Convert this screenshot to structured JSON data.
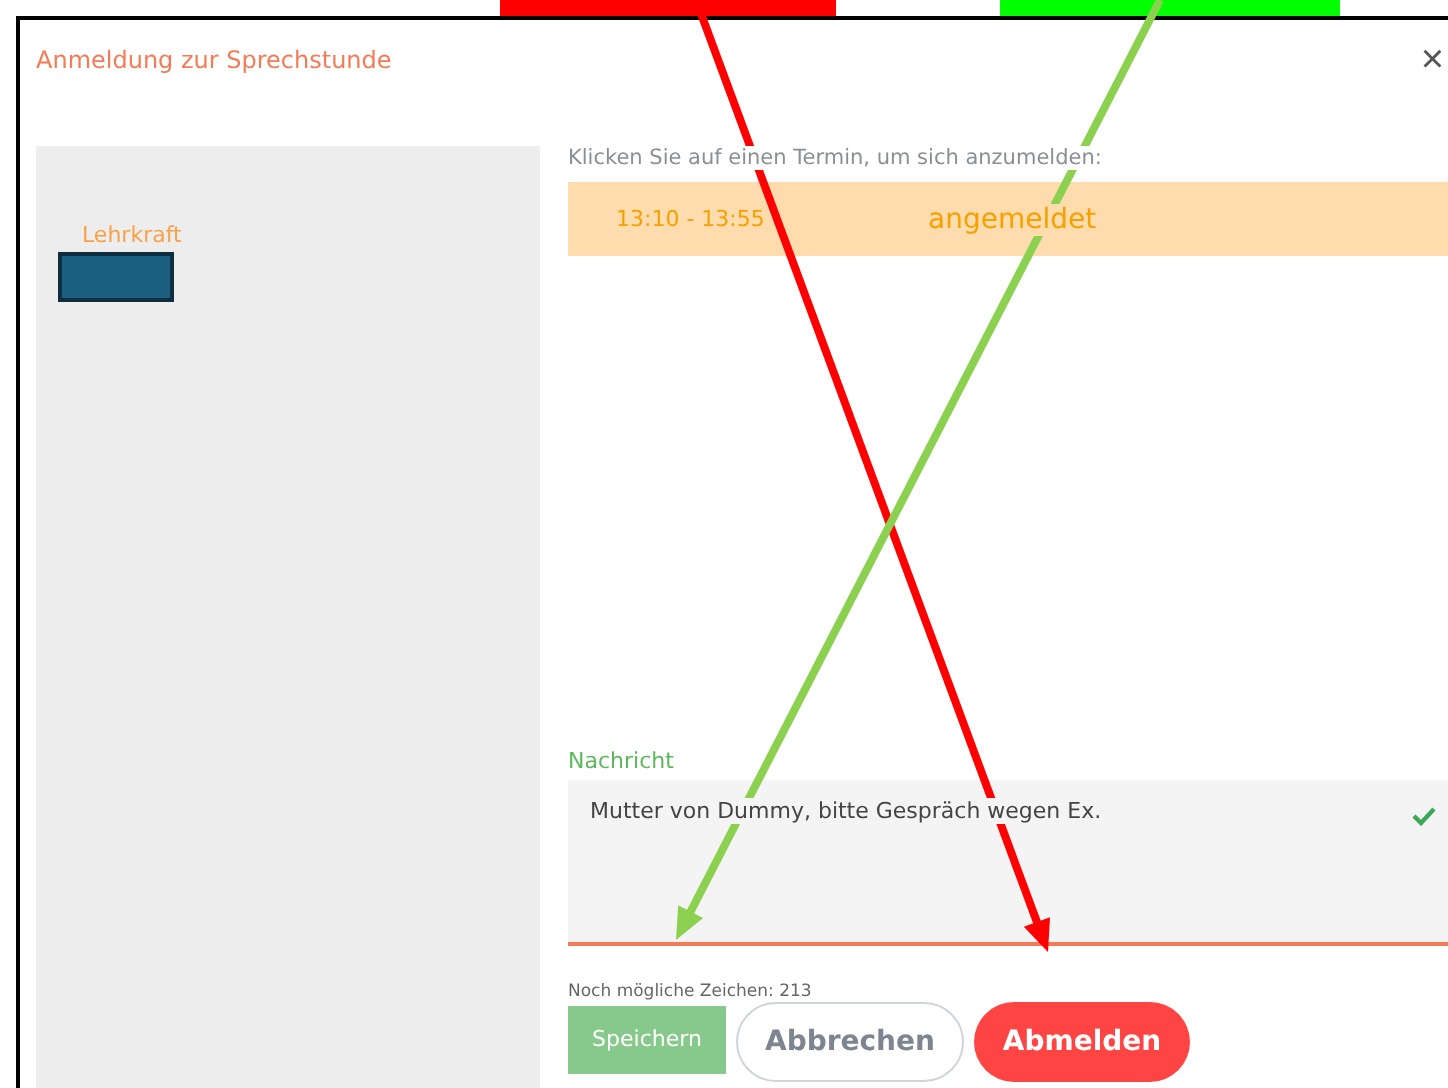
{
  "dialog": {
    "title": "Anmeldung zur Sprechstunde",
    "close": "×"
  },
  "sidebar": {
    "label": "Lehrkraft"
  },
  "slots": {
    "instruction": "Klicken Sie auf einen Termin, um sich anzumelden:",
    "items": [
      {
        "time": "13:10 - 13:55",
        "status": "angemeldet",
        "selected": true
      }
    ]
  },
  "message": {
    "label": "Nachricht",
    "value": "Mutter von Dummy, bitte Gespräch wegen Ex.",
    "valid": true,
    "remaining": "Noch mögliche Zeichen: 213"
  },
  "buttons": [
    {
      "label": "Speichern",
      "kind": "save"
    },
    {
      "label": "Abbrechen",
      "kind": "cancel"
    },
    {
      "label": "Abmelden",
      "kind": "danger"
    }
  ],
  "annotations": [
    {
      "kind": "arrow",
      "color": "#ff0000"
    },
    {
      "kind": "arrow",
      "color": "#8bd14f"
    }
  ]
}
